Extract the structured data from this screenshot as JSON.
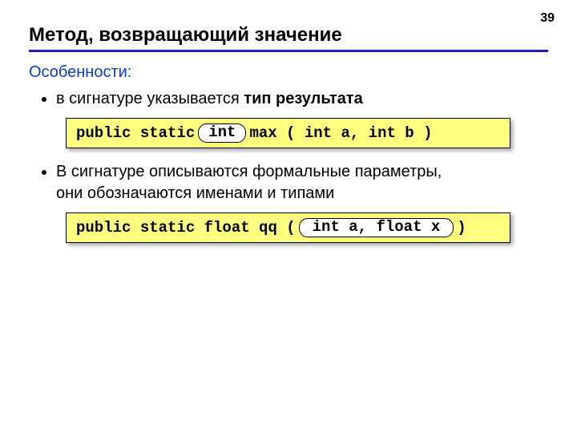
{
  "page_number": "39",
  "title": "Метод, возвращающий значение",
  "subhead": "Особенности:",
  "bullets": {
    "b1_pre": "в сигнатуре указывается ",
    "b1_bold": "тип результата",
    "b2_line1": "В сигнатуре описываются формальные параметры,",
    "b2_line2": "они обозначаются именами и типами"
  },
  "code1": {
    "pre": "public static ",
    "pill": "int",
    "post": " max ( int a, int b )"
  },
  "code2": {
    "pre": "public static float qq ( ",
    "pill": "int a, float x",
    "post": " )"
  }
}
